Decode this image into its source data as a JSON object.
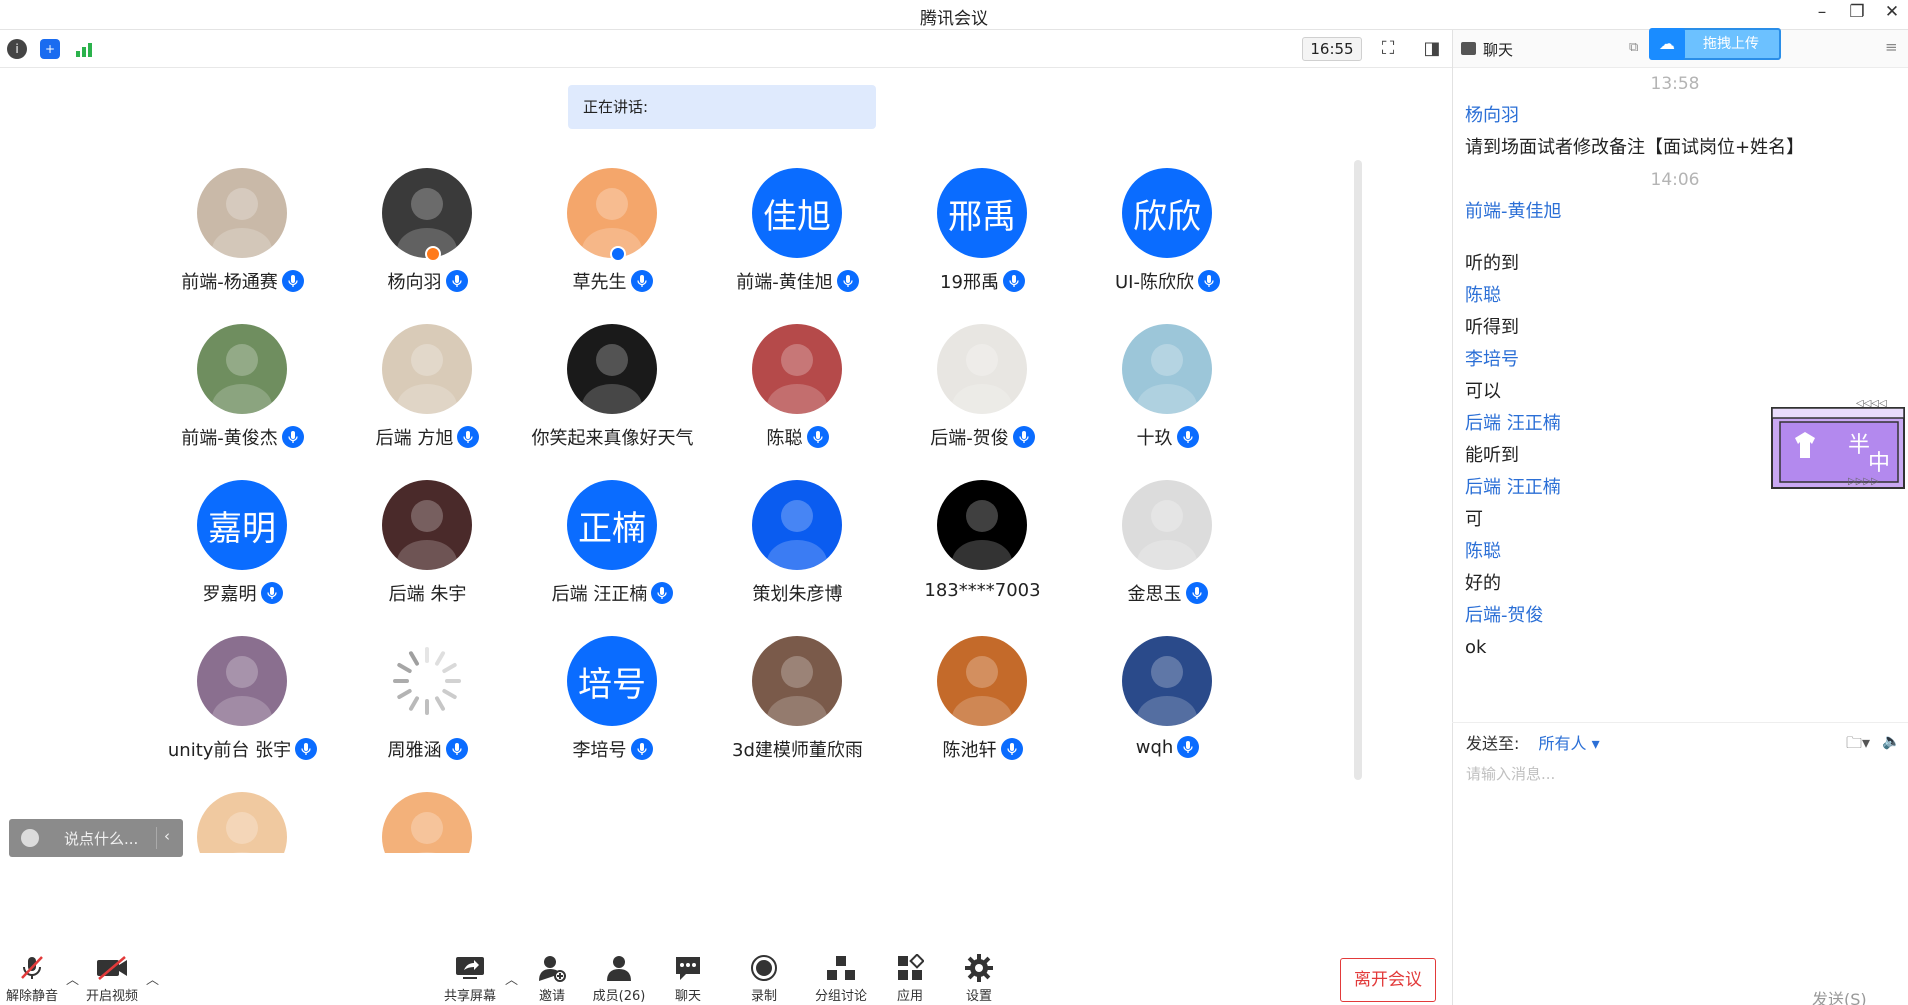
{
  "window": {
    "title": "腾讯会议"
  },
  "toolbar": {
    "clock": "16:55"
  },
  "speaking": {
    "label": "正在讲话:"
  },
  "participants": [
    {
      "name": "前端-杨通赛",
      "avatar_text": "",
      "avatar_color": "#c9b9a8",
      "mic": true
    },
    {
      "name": "杨向羽",
      "avatar_text": "",
      "avatar_color": "#3a3a3a",
      "mic": true,
      "badge": "host"
    },
    {
      "name": "草先生",
      "avatar_text": "",
      "avatar_color": "#f4a66b",
      "mic": true,
      "badge": "cohost"
    },
    {
      "name": "前端-黄佳旭",
      "avatar_text": "佳旭",
      "avatar_color": "#0a6cff",
      "mic": true
    },
    {
      "name": "19邢禹",
      "avatar_text": "邢禹",
      "avatar_color": "#0a6cff",
      "mic": true
    },
    {
      "name": "UI-陈欣欣",
      "avatar_text": "欣欣",
      "avatar_color": "#0a6cff",
      "mic": true
    },
    {
      "name": "前端-黄俊杰",
      "avatar_text": "",
      "avatar_color": "#6f8e5f",
      "mic": true
    },
    {
      "name": "后端 方旭",
      "avatar_text": "",
      "avatar_color": "#d9cbb8",
      "mic": true
    },
    {
      "name": "你笑起来真像好天气",
      "avatar_text": "",
      "avatar_color": "#1a1a1a",
      "mic": false
    },
    {
      "name": "陈聪",
      "avatar_text": "",
      "avatar_color": "#b54a4a",
      "mic": true
    },
    {
      "name": "后端-贺俊",
      "avatar_text": "",
      "avatar_color": "#e8e6e2",
      "mic": true
    },
    {
      "name": "十玖",
      "avatar_text": "",
      "avatar_color": "#9cc6d9",
      "mic": true
    },
    {
      "name": "罗嘉明",
      "avatar_text": "嘉明",
      "avatar_color": "#0a6cff",
      "mic": true
    },
    {
      "name": "后端 朱宇",
      "avatar_text": "",
      "avatar_color": "#4a2a2a",
      "mic": false
    },
    {
      "name": "后端 汪正楠",
      "avatar_text": "正楠",
      "avatar_color": "#0a6cff",
      "mic": true
    },
    {
      "name": "策划朱彦博",
      "avatar_text": "",
      "avatar_color": "#0a5cf0",
      "mic": false
    },
    {
      "name": "183****7003",
      "avatar_text": "",
      "avatar_color": "#000000",
      "mic": false
    },
    {
      "name": "金思玉",
      "avatar_text": "",
      "avatar_color": "#dcdcdc",
      "mic": true
    },
    {
      "name": "unity前台 张宇",
      "avatar_text": "",
      "avatar_color": "#8a6f8f",
      "mic": true
    },
    {
      "name": "周雅涵",
      "avatar_text": "",
      "avatar_color": "#ffffff",
      "mic": true,
      "loading": true
    },
    {
      "name": "李培号",
      "avatar_text": "培号",
      "avatar_color": "#0a6cff",
      "mic": true
    },
    {
      "name": "3d建模师董欣雨",
      "avatar_text": "",
      "avatar_color": "#7a5a4a",
      "mic": false
    },
    {
      "name": "陈池轩",
      "avatar_text": "",
      "avatar_color": "#c46a2a",
      "mic": true
    },
    {
      "name": "wqh",
      "avatar_text": "",
      "avatar_color": "#2a4a8a",
      "mic": true
    },
    {
      "name": "",
      "avatar_text": "",
      "avatar_color": "#f0c9a0",
      "mic": false
    },
    {
      "name": "",
      "avatar_text": "",
      "avatar_color": "#f3b17a",
      "mic": false
    }
  ],
  "say_box": {
    "placeholder": "说点什么..."
  },
  "bottom": {
    "unmute": "解除静音",
    "video": "开启视频",
    "share": "共享屏幕",
    "invite": "邀请",
    "members": "成员(26)",
    "chat": "聊天",
    "record": "录制",
    "breakout": "分组讨论",
    "apps": "应用",
    "settings": "设置",
    "leave": "离开会议"
  },
  "chat": {
    "title": "聊天",
    "upload": "拖拽上传",
    "messages": [
      {
        "type": "time",
        "text": "13:58"
      },
      {
        "type": "sender",
        "text": "杨向羽"
      },
      {
        "type": "msg",
        "text": "请到场面试者修改备注【面试岗位+姓名】"
      },
      {
        "type": "time",
        "text": "14:06"
      },
      {
        "type": "sender",
        "text": "前端-黄佳旭"
      },
      {
        "type": "msg",
        "text": "听的到",
        "gap": true
      },
      {
        "type": "sender",
        "text": "陈聪"
      },
      {
        "type": "msg",
        "text": "听得到"
      },
      {
        "type": "sender",
        "text": "李培号"
      },
      {
        "type": "msg",
        "text": "可以"
      },
      {
        "type": "sender",
        "text": "后端 汪正楠"
      },
      {
        "type": "msg",
        "text": "能听到"
      },
      {
        "type": "sender",
        "text": "后端 汪正楠"
      },
      {
        "type": "msg",
        "text": "可"
      },
      {
        "type": "sender",
        "text": "陈聪"
      },
      {
        "type": "msg",
        "text": "好的"
      },
      {
        "type": "sender",
        "text": "后端-贺俊"
      },
      {
        "type": "msg",
        "text": "ok"
      }
    ],
    "send_to_label": "发送至:",
    "send_to_value": "所有人",
    "input_placeholder": "请输入消息...",
    "send_button": "发送(S)"
  },
  "sticker": {
    "text1": "半",
    "text2": "中"
  }
}
